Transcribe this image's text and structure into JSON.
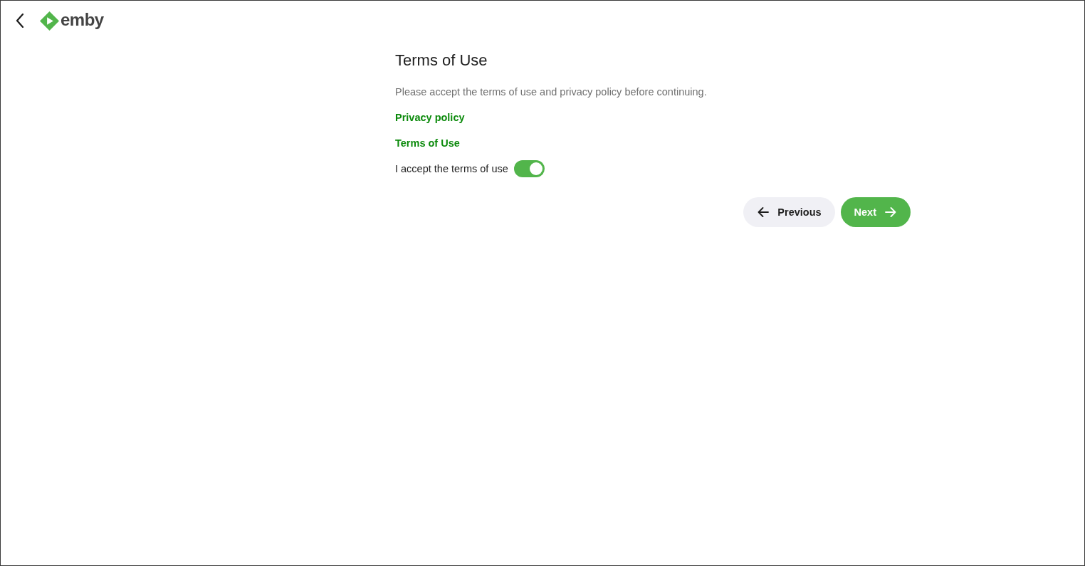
{
  "header": {
    "logo_text": "emby"
  },
  "page": {
    "title": "Terms of Use",
    "description": "Please accept the terms of use and privacy policy before continuing.",
    "links": [
      "Privacy policy",
      "Terms of Use"
    ],
    "accept_toggle": {
      "label": "I accept the terms of use",
      "on": true
    }
  },
  "buttons": [
    {
      "label": "Previous",
      "kind": "previous"
    },
    {
      "label": "Next",
      "kind": "next"
    }
  ]
}
